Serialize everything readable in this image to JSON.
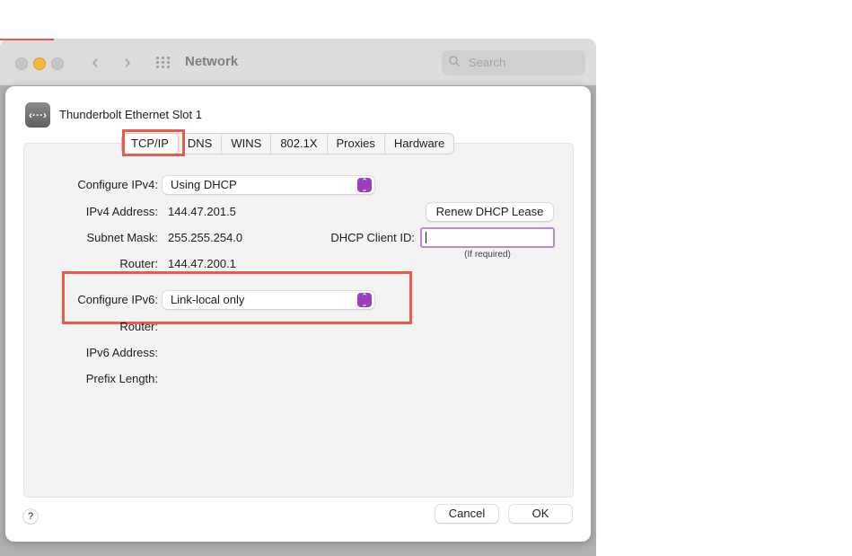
{
  "window": {
    "title": "Network",
    "search_placeholder": "Search",
    "back_glyph": "‹",
    "forward_glyph": "›"
  },
  "sheet": {
    "interface_name": "Thunderbolt Ethernet Slot 1",
    "interface_icon": "‹···›",
    "tabs": [
      {
        "label": "TCP/IP",
        "selected": true
      },
      {
        "label": "DNS"
      },
      {
        "label": "WINS"
      },
      {
        "label": "802.1X"
      },
      {
        "label": "Proxies"
      },
      {
        "label": "Hardware"
      }
    ],
    "ipv4": {
      "configure_label": "Configure IPv4:",
      "configure_value": "Using DHCP",
      "address_label": "IPv4 Address:",
      "address_value": "144.47.201.5",
      "subnet_label": "Subnet Mask:",
      "subnet_value": "255.255.254.0",
      "router_label": "Router:",
      "router_value": "144.47.200.1"
    },
    "dhcp": {
      "renew_label": "Renew DHCP Lease",
      "client_id_label": "DHCP Client ID:",
      "client_id_value": "",
      "hint": "(If required)"
    },
    "ipv6": {
      "configure_label": "Configure IPv6:",
      "configure_value": "Link-local only",
      "router_label": "Router:",
      "address_label": "IPv6 Address:",
      "prefix_label": "Prefix Length:"
    },
    "help_label": "?",
    "cancel_label": "Cancel",
    "ok_label": "OK"
  },
  "colors": {
    "highlight": "#ea5a4f",
    "accent": "#9a3fbd",
    "traffic_minimize": "#f5b83a"
  },
  "icons": [
    "search-icon",
    "grid-icon",
    "ethernet-icon",
    "popup-arrows-icon",
    "help-icon",
    "chevron-left-icon",
    "chevron-right-icon"
  ]
}
